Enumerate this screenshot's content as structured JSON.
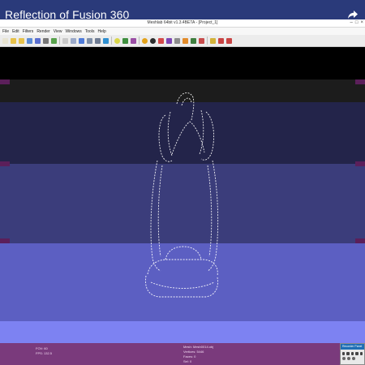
{
  "overlay": {
    "title": "Reflection of Fusion 360",
    "share_icon": "share-arrow-icon"
  },
  "window": {
    "caption": "Meshlab 64bit v1.3.4BETA - [Project_1]",
    "controls": [
      "–",
      "□",
      "×"
    ]
  },
  "menu": [
    "File",
    "Edit",
    "Filters",
    "Render",
    "View",
    "Windows",
    "Tools",
    "Help"
  ],
  "toolbar": {
    "buttons": [
      {
        "icon": "new-icon",
        "color": "#e8e4d2"
      },
      {
        "icon": "open-folder-icon",
        "color": "#e6c14a"
      },
      {
        "icon": "open-folder-icon",
        "color": "#e6c14a"
      },
      {
        "icon": "reload-icon",
        "color": "#5a8ad6"
      },
      {
        "icon": "save-icon",
        "color": "#5a6ecf"
      },
      {
        "icon": "snapshot-icon",
        "color": "#777777"
      },
      {
        "icon": "layers-icon",
        "color": "#57a14b"
      },
      {
        "icon": "sep"
      },
      {
        "icon": "points-icon",
        "color": "#c9c9c9"
      },
      {
        "icon": "wireframe-icon",
        "color": "#9aa9c9"
      },
      {
        "icon": "hidden-lines-icon",
        "color": "#4f7bd9"
      },
      {
        "icon": "flat-lines-icon",
        "color": "#7d8ea8"
      },
      {
        "icon": "flat-icon",
        "color": "#6f7c93"
      },
      {
        "icon": "smooth-icon",
        "color": "#2f8fd0"
      },
      {
        "icon": "sep"
      },
      {
        "icon": "light-icon",
        "color": "#d9d64a"
      },
      {
        "icon": "double-face-icon",
        "color": "#3f8f3f"
      },
      {
        "icon": "cull-face-icon",
        "color": "#9a4ea5"
      },
      {
        "icon": "sep"
      },
      {
        "icon": "info-icon",
        "color": "#e3a21a"
      },
      {
        "icon": "color-icon",
        "color": "#2c2c2c"
      },
      {
        "icon": "select-faces-icon",
        "color": "#d44a4a"
      },
      {
        "icon": "select-vertices-icon",
        "color": "#7e46b5"
      },
      {
        "icon": "measure-icon",
        "color": "#8c8c8c"
      },
      {
        "icon": "paint-icon",
        "color": "#e28b2a"
      },
      {
        "icon": "align-icon",
        "color": "#3f7f3f"
      },
      {
        "icon": "pick-points-icon",
        "color": "#c84c4c"
      },
      {
        "icon": "sep"
      },
      {
        "icon": "manipulator-icon",
        "color": "#d3b33a"
      },
      {
        "icon": "delete-face-icon",
        "color": "#c94444"
      },
      {
        "icon": "delete-vertex-icon",
        "color": "#c94444"
      }
    ]
  },
  "viewport": {
    "colors": {
      "band_black": "#000000",
      "band_dark": "#1c1c1c",
      "band_navy": "#23244a",
      "band_indigo": "#3b3d7b",
      "band_periwinkle": "#5c5fc2",
      "band_light": "#7d82f2",
      "edge_marker": "#5b1f5a",
      "mesh_point": "#ffffff"
    }
  },
  "status": {
    "fps_label": "FOV: 60",
    "fps_value": "FPS:   132.5",
    "mesh_name": "Mesh: Mesh0014.obj",
    "vertices": "Vertices: 5446",
    "faces": "Faces: 0",
    "selection": "Sel: 0"
  },
  "recorder": {
    "title": "Recorder Panel"
  }
}
